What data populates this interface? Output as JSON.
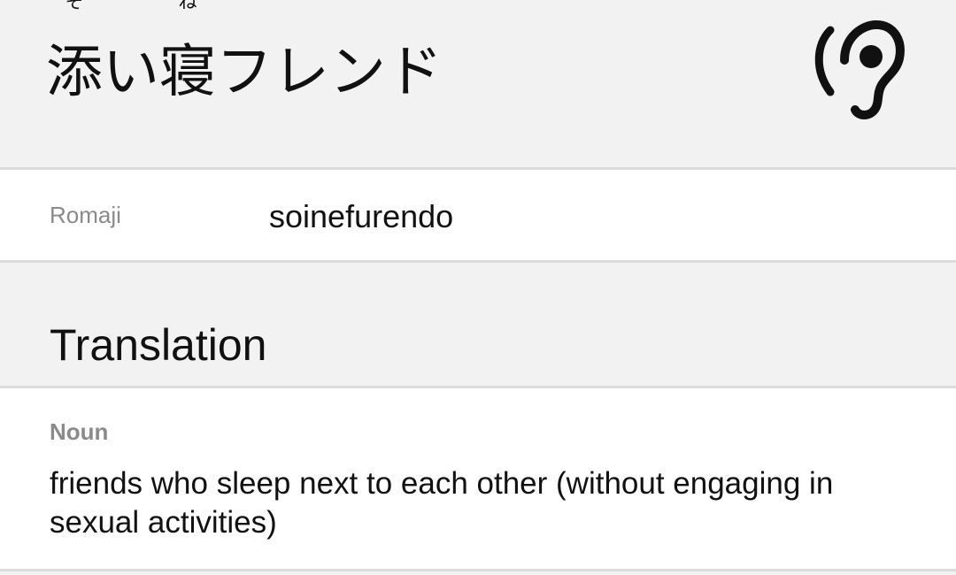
{
  "entry": {
    "segments": [
      {
        "text": "添",
        "furigana": "そ"
      },
      {
        "text": "い",
        "furigana": ""
      },
      {
        "text": "寝",
        "furigana": "ね"
      },
      {
        "text": "フレンド",
        "furigana": ""
      }
    ],
    "audio_icon": "hearing-ear-icon"
  },
  "romaji": {
    "label": "Romaji",
    "value": "soinefurendo"
  },
  "translation": {
    "title": "Translation",
    "part_of_speech": "Noun",
    "meaning": "friends who sleep next to each other (without engaging in sexual activities)"
  }
}
